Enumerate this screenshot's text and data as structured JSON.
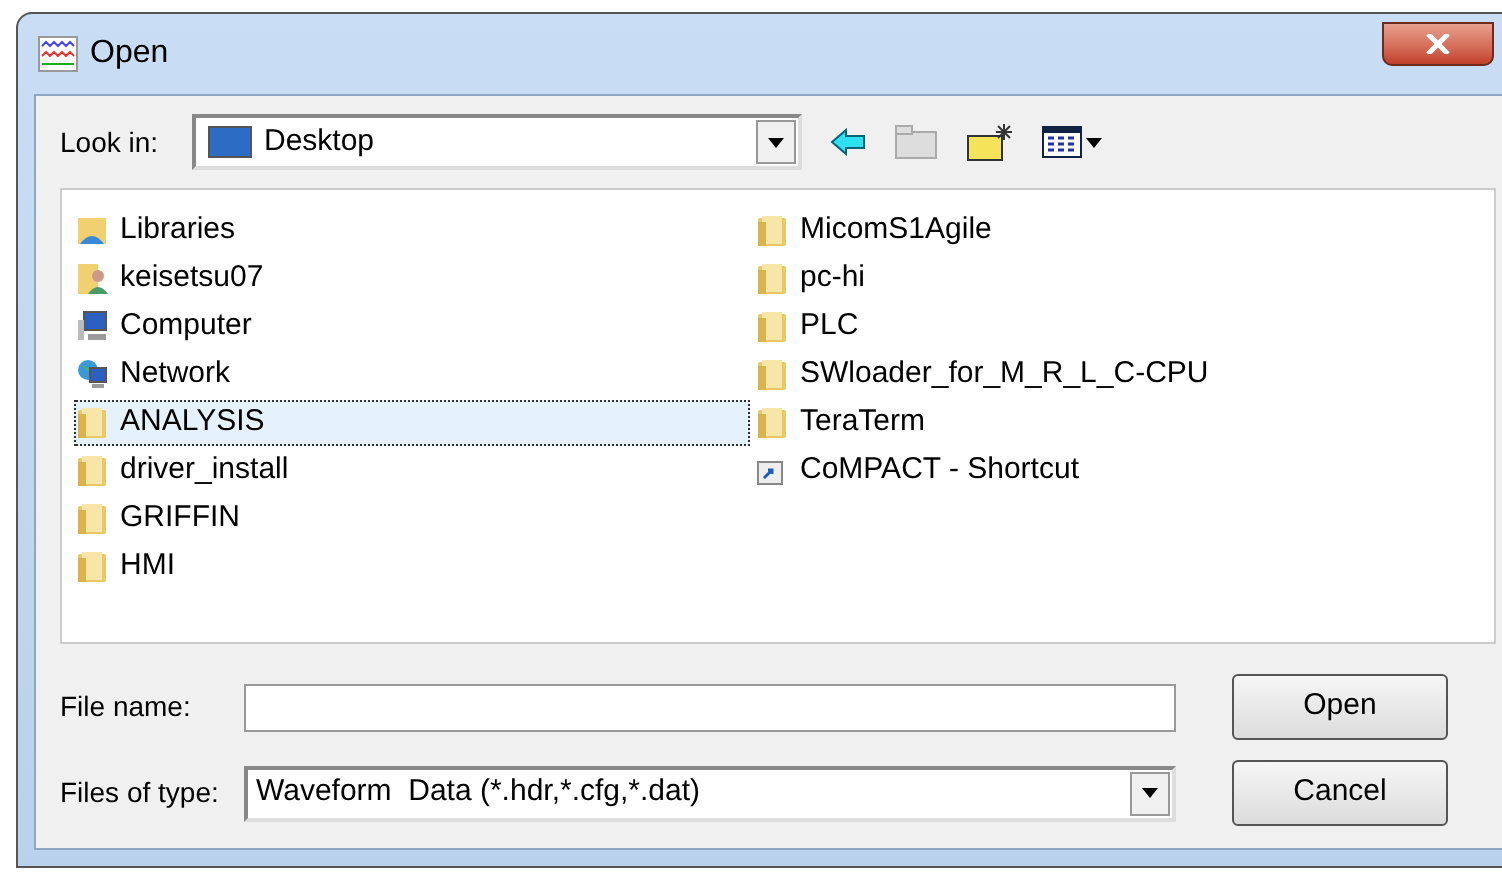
{
  "window": {
    "title": "Open"
  },
  "look_in": {
    "label": "Look in:",
    "value": "Desktop"
  },
  "items": [
    {
      "name": "Libraries",
      "kind": "libraries",
      "selected": false
    },
    {
      "name": "keisetsu07",
      "kind": "user",
      "selected": false
    },
    {
      "name": "Computer",
      "kind": "computer",
      "selected": false
    },
    {
      "name": "Network",
      "kind": "network",
      "selected": false
    },
    {
      "name": "ANALYSIS",
      "kind": "folder",
      "selected": true
    },
    {
      "name": "driver_install",
      "kind": "folder",
      "selected": false
    },
    {
      "name": "GRIFFIN",
      "kind": "folder",
      "selected": false
    },
    {
      "name": "HMI",
      "kind": "folder",
      "selected": false
    },
    {
      "name": "MicomS1Agile",
      "kind": "folder",
      "selected": false
    },
    {
      "name": "pc-hi",
      "kind": "folder",
      "selected": false
    },
    {
      "name": "PLC",
      "kind": "folder",
      "selected": false
    },
    {
      "name": "SWloader_for_M_R_L_C-CPU",
      "kind": "folder",
      "selected": false
    },
    {
      "name": "TeraTerm",
      "kind": "folder",
      "selected": false
    },
    {
      "name": "CoMPACT - Shortcut",
      "kind": "shortcut",
      "selected": false
    }
  ],
  "file_name": {
    "label": "File name:"
  },
  "file_type": {
    "label": "Files of type:",
    "value": "Waveform  Data (*.hdr,*.cfg,*.dat)"
  },
  "buttons": [
    "Open",
    "Cancel"
  ]
}
